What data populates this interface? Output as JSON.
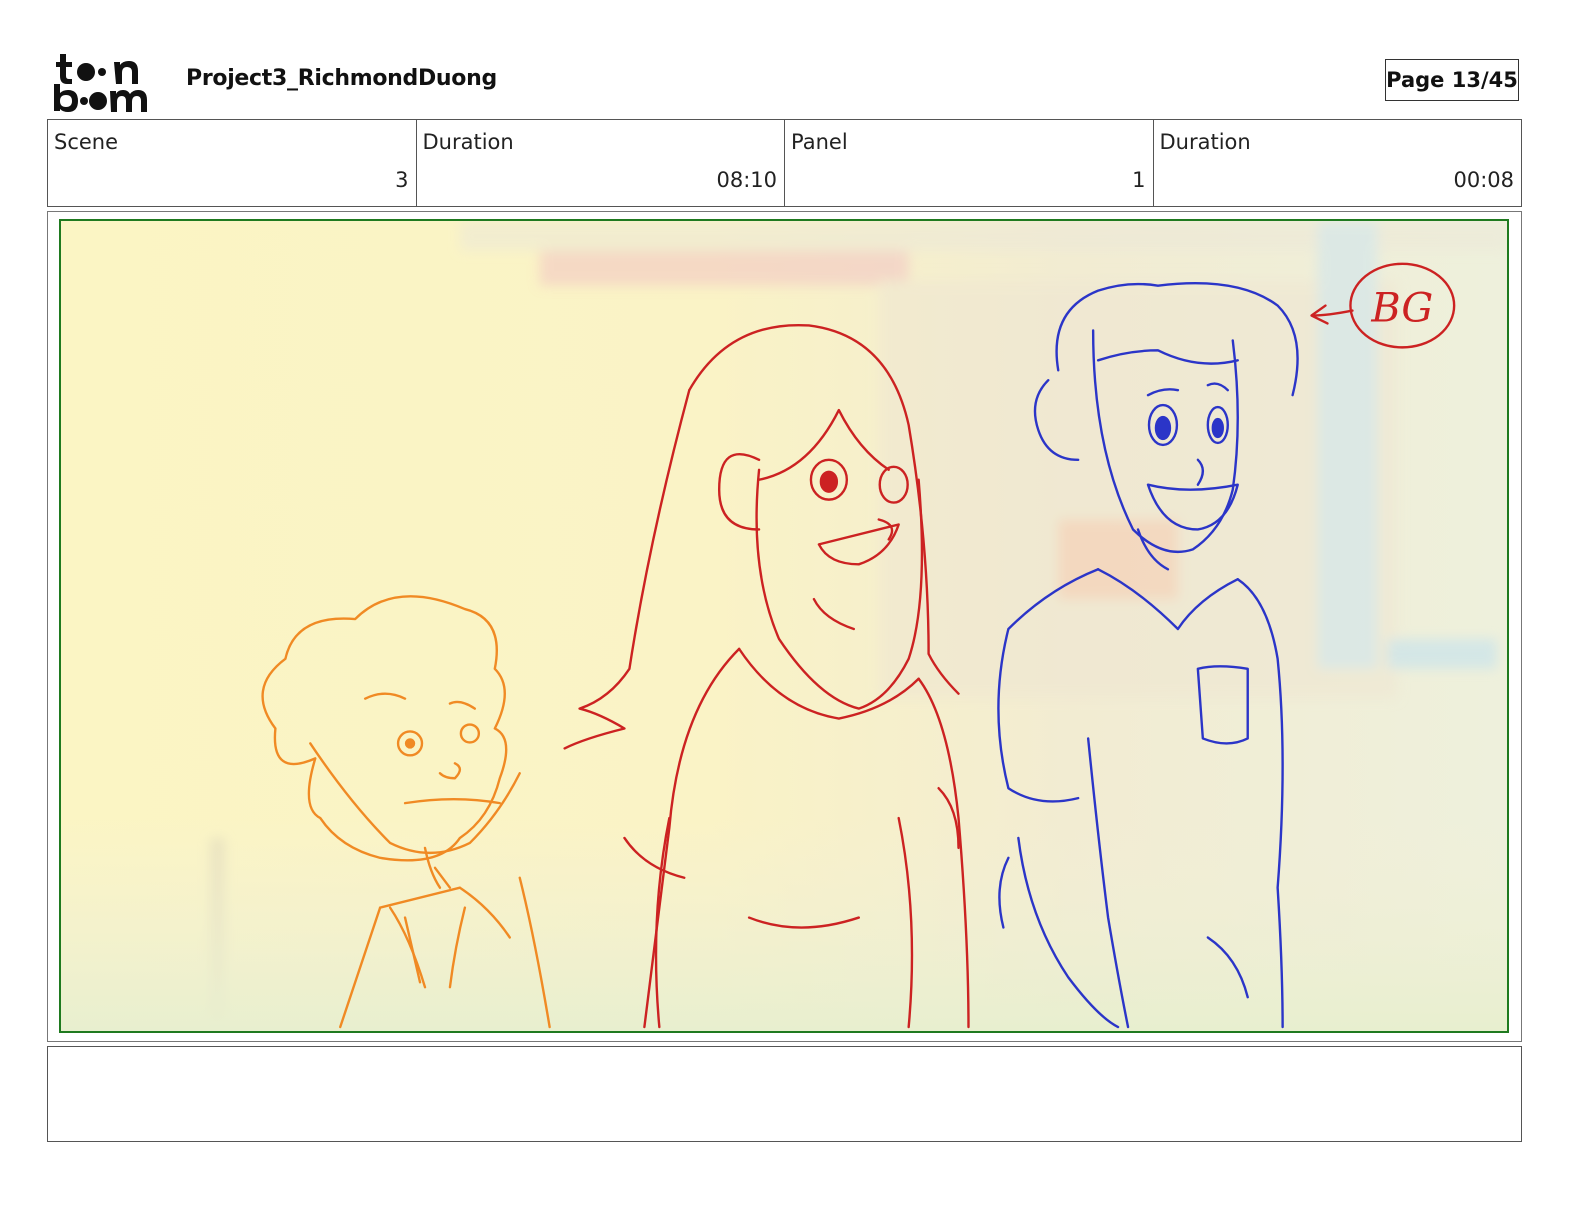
{
  "header": {
    "logo_text": "toon boom",
    "project_title": "Project3_RichmondDuong",
    "page_label": "Page 13/45"
  },
  "info": [
    {
      "label": "Scene",
      "value": "3"
    },
    {
      "label": "Duration",
      "value": "08:10"
    },
    {
      "label": "Panel",
      "value": "1"
    },
    {
      "label": "Duration",
      "value": "00:08"
    }
  ],
  "panel": {
    "annotation_text": "BG",
    "colors": {
      "frame": "#1f7a1f",
      "boy_sketch": "#f08a24",
      "girl_sketch": "#cc2222",
      "man_sketch": "#2b35c8",
      "annotation": "#cc2222"
    }
  },
  "notes": {
    "text": ""
  }
}
